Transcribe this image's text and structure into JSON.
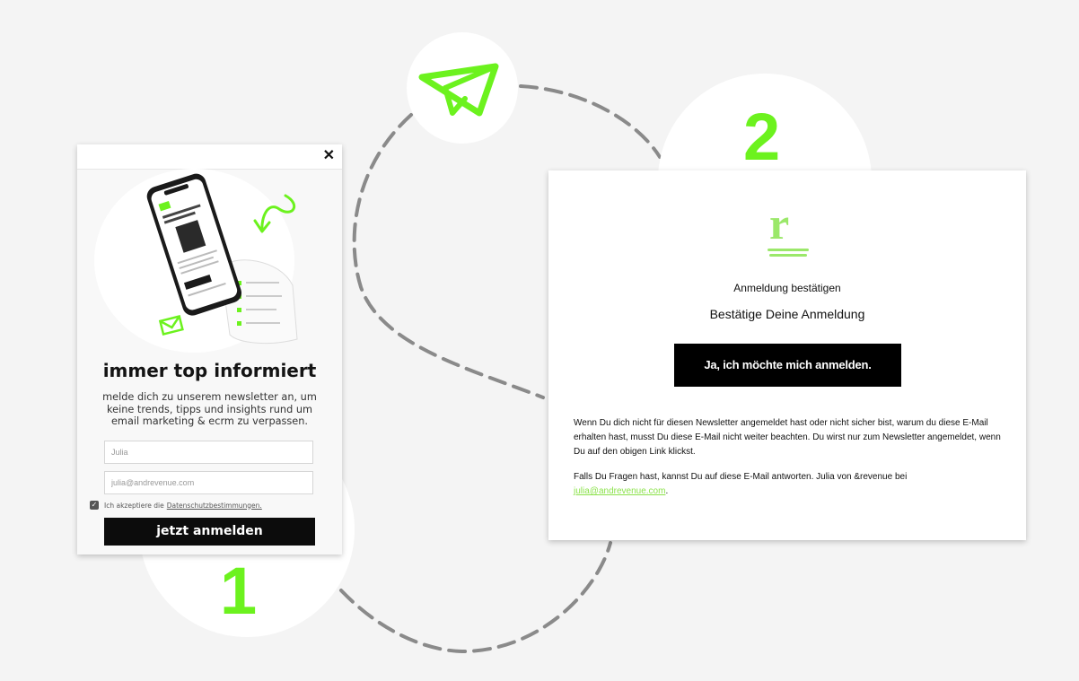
{
  "colors": {
    "accent": "#6cf21e",
    "dark": "#0c0c0c",
    "background": "#f4f4f4"
  },
  "steps": {
    "one": "1",
    "two": "2"
  },
  "popup": {
    "close_icon": "close-icon",
    "title": "immer top informiert",
    "description": "melde dich zu unserem newsletter an, um keine trends, tipps und insights rund um email marketing & ecrm zu verpassen.",
    "name_value": "Julia",
    "email_value": "julia@andrevenue.com",
    "consent_text": "Ich akzeptiere die",
    "consent_link": "Datenschutzbestimmungen.",
    "submit_label": "jetzt anmelden"
  },
  "email": {
    "logo_letter": "r",
    "subject": "Anmeldung bestätigen",
    "headline": "Bestätige Deine Anmeldung",
    "confirm_label": "Ja, ich möchte mich anmelden.",
    "paragraph_1": "Wenn Du dich nicht für diesen Newsletter angemeldet hast oder nicht sicher bist, warum du diese E-Mail erhalten hast, musst Du diese E-Mail nicht weiter beachten. Du wirst nur zum Newsletter angemeldet, wenn Du auf den obigen Link klickst.",
    "paragraph_2_text": "Falls Du Fragen hast, kannst Du auf diese E-Mail antworten. Julia von &revenue bei",
    "paragraph_2_link": "julia@andrevenue.com",
    "paragraph_2_end": "."
  }
}
